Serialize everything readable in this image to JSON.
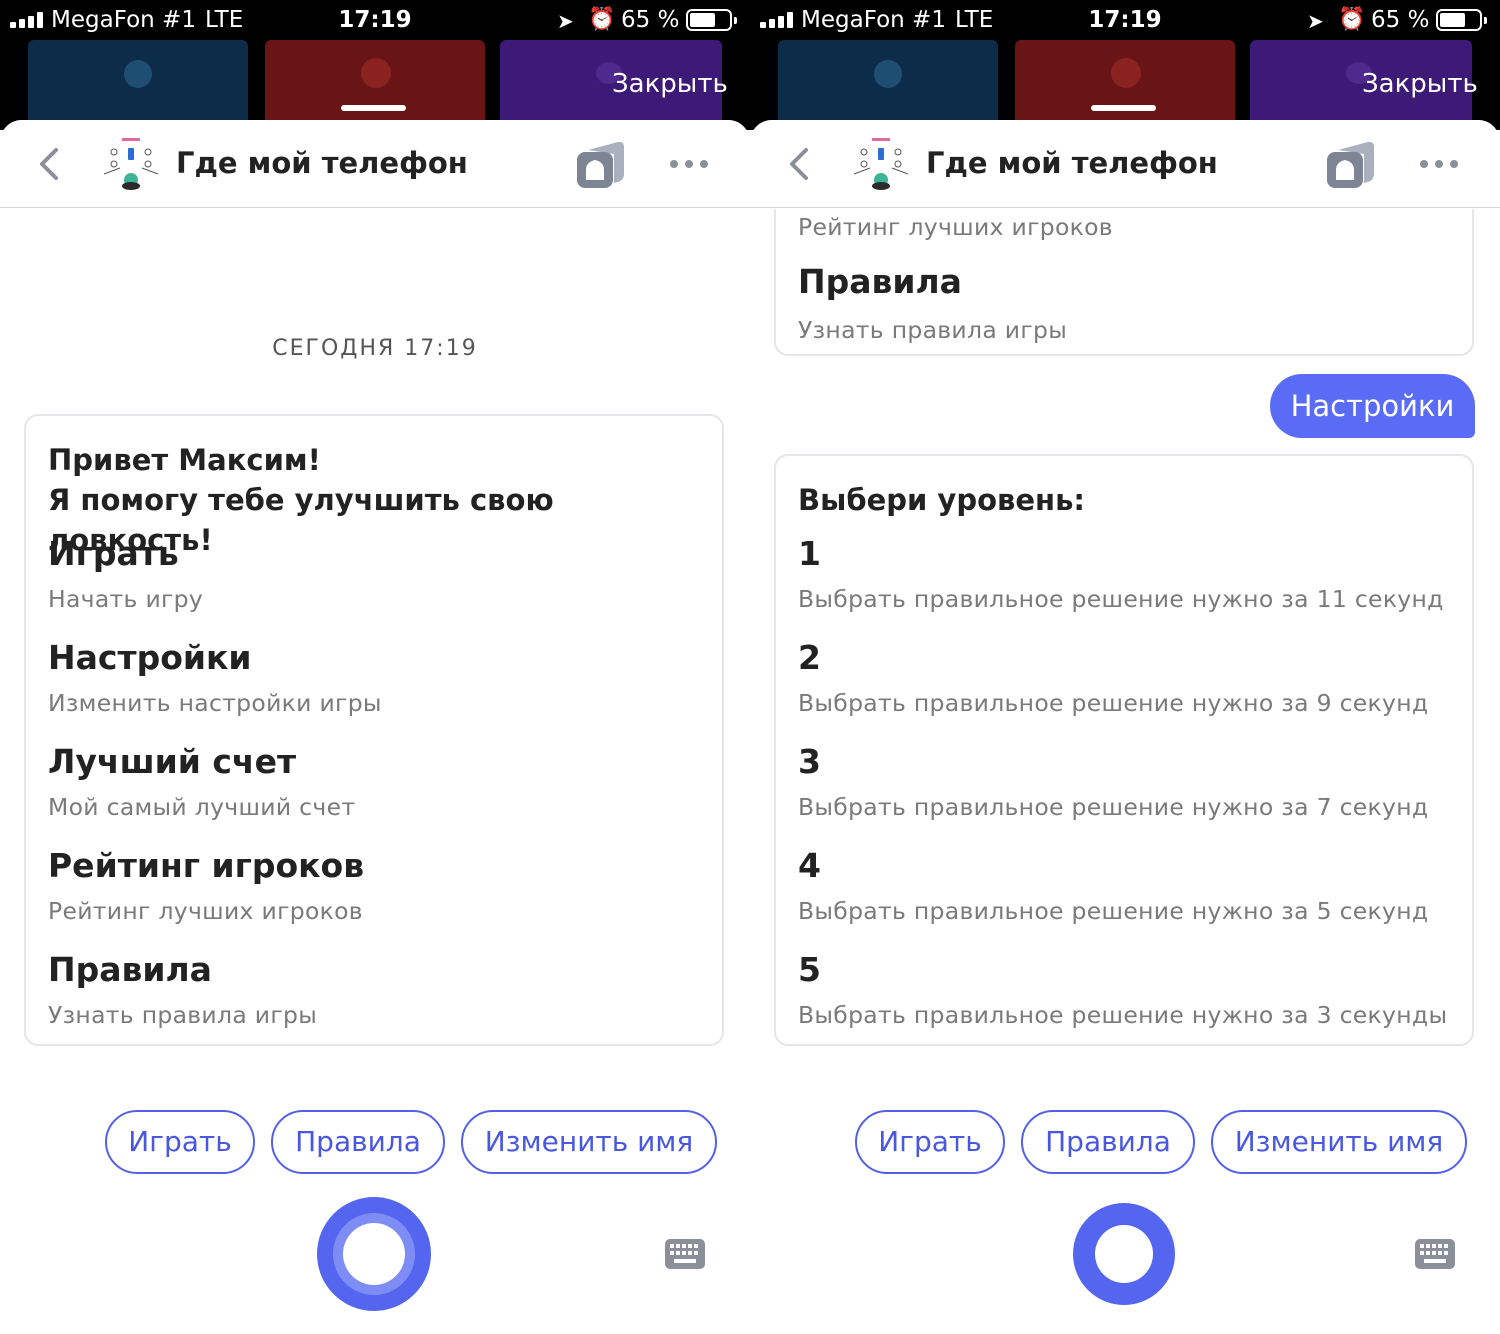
{
  "status_bar": {
    "carrier": "MegaFon #1",
    "network": "LTE",
    "time": "17:19",
    "battery": "65 %",
    "battery_level": 0.65
  },
  "overlay": {
    "close_label": "Закрыть"
  },
  "header": {
    "title": "Где мой телефон"
  },
  "left_chat": {
    "date": "СЕГОДНЯ 17:19",
    "greeting_line1": "Привет Максим!",
    "greeting_line2": "Я помогу тебе улучшить свою ловкость!",
    "options": [
      {
        "title": "Играть",
        "subtitle": "Начать игру"
      },
      {
        "title": "Настройки",
        "subtitle": "Изменить настройки игры"
      },
      {
        "title": "Лучший счет",
        "subtitle": "Мой самый лучший счет"
      },
      {
        "title": "Рейтинг игроков",
        "subtitle": "Рейтинг лучших игроков"
      },
      {
        "title": "Правила",
        "subtitle": "Узнать правила игры"
      }
    ]
  },
  "right_chat": {
    "prev_card": {
      "last_subtitle_partial": "Рейтинг лучших игроков",
      "title": "Правила",
      "subtitle": "Узнать правила игры"
    },
    "user_message": "Настройки",
    "level_card": {
      "heading": "Выбери уровень:",
      "levels": [
        {
          "title": "1",
          "subtitle": "Выбрать правильное решение нужно за 11 секунд"
        },
        {
          "title": "2",
          "subtitle": "Выбрать правильное решение нужно за 9 секунд"
        },
        {
          "title": "3",
          "subtitle": "Выбрать правильное решение нужно за 7 секунд"
        },
        {
          "title": "4",
          "subtitle": "Выбрать правильное решение нужно за 5 секунд"
        },
        {
          "title": "5",
          "subtitle": "Выбрать правильное решение нужно за 3 секунды"
        }
      ]
    }
  },
  "suggests": [
    "Играть",
    "Правила",
    "Изменить имя"
  ],
  "colors": {
    "accent": "#5466ef",
    "chip_border": "#5260e8",
    "user_bubble": "#5a6cf5",
    "status_bar": "#000000"
  },
  "icons": {
    "back": "chevron-left-icon",
    "alice": "alice-house-icon",
    "more": "more-dots-icon",
    "mic": "alice-mic-icon",
    "keyboard": "keyboard-icon",
    "location": "location-arrow-icon",
    "alarm": "alarm-icon"
  }
}
